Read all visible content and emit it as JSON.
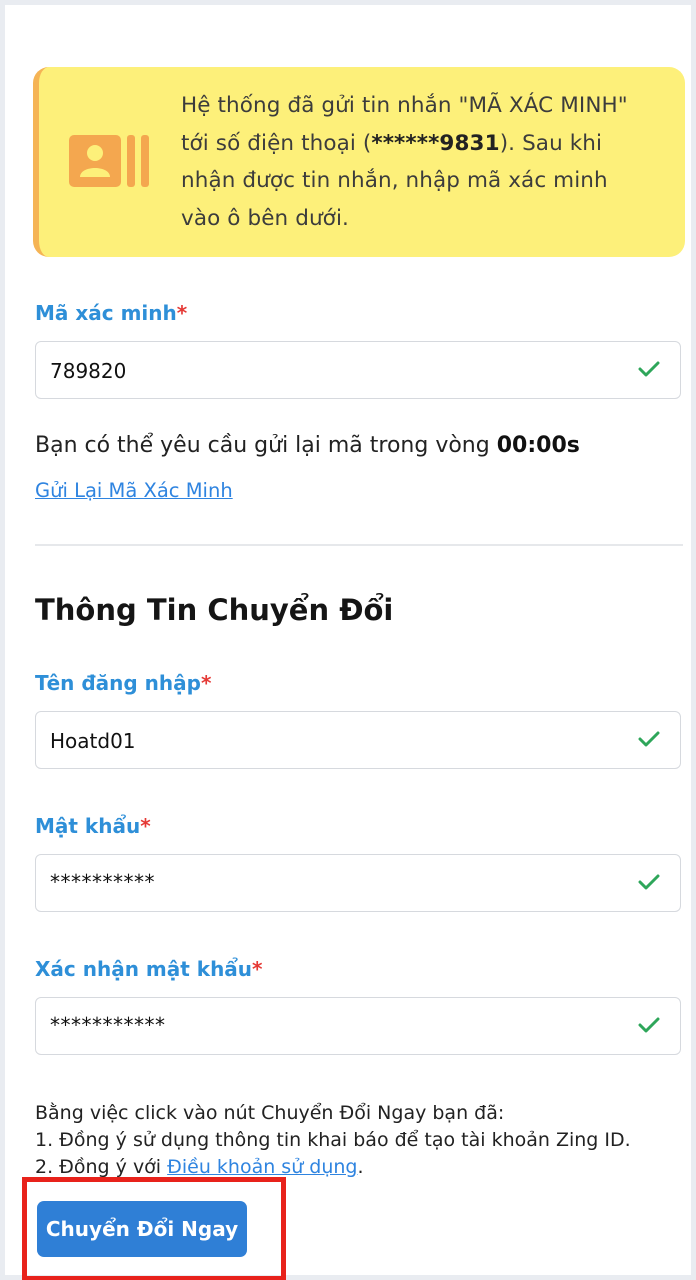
{
  "notice": {
    "icon": "contact-card-icon",
    "line_prefix": "Hệ thống đã gửi tin nhắn \"MÃ XÁC MINH\" tới số điện thoại (",
    "phone_masked": "******9831",
    "line_suffix": ").",
    "instruction": "Sau khi nhận được tin nhắn, nhập mã xác minh vào ô bên dưới."
  },
  "verification": {
    "label": "Mã xác minh",
    "value": "789820",
    "resend_text": "Bạn có thể yêu cầu gửi lại mã trong vòng ",
    "countdown": "00:00s",
    "resend_link": "Gửi Lại Mã Xác Minh"
  },
  "section": {
    "title": "Thông Tin Chuyển Đổi"
  },
  "form": {
    "username_label": "Tên đăng nhập",
    "username_value": "Hoatd01",
    "password_label": "Mật khẩu",
    "password_value": "**********",
    "confirm_label": "Xác nhận mật khẩu",
    "confirm_value": "***********",
    "required_mark": "*"
  },
  "terms": {
    "intro": "Bằng việc click vào nút Chuyển Đổi Ngay bạn đã:",
    "item1": "1. Đồng ý sử dụng thông tin khai báo để tạo tài khoản Zing ID.",
    "item2_prefix": "2. Đồng ý với ",
    "item2_link": "Điều khoản sử dụng",
    "item2_suffix": "."
  },
  "cta": {
    "label": "Chuyển Đổi Ngay"
  },
  "colors": {
    "accent": "#2f7fd6",
    "label_blue": "#2e8fd8",
    "notice_bg": "#fdf07a",
    "notice_border": "#f5b455",
    "success_check": "#2ea65a",
    "highlight_box": "#e8221b"
  }
}
